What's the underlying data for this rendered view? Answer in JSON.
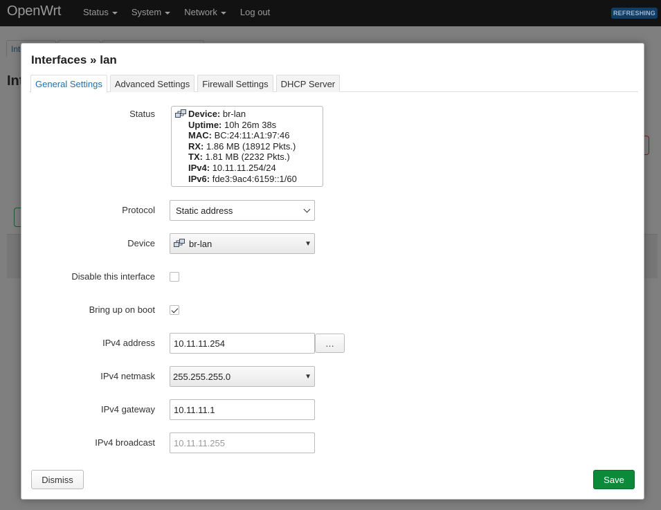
{
  "header": {
    "brand": "OpenWrt",
    "menu": [
      "Status",
      "System",
      "Network"
    ],
    "logout": "Log out",
    "badge": "REFRESHING"
  },
  "background": {
    "tabs": [
      "Int",
      "",
      ""
    ],
    "title": "Int"
  },
  "modal": {
    "title": "Interfaces » lan",
    "tabs": [
      "General Settings",
      "Advanced Settings",
      "Firewall Settings",
      "DHCP Server"
    ],
    "status": {
      "label": "Status",
      "lines": [
        {
          "key": "Device:",
          "value": "br-lan"
        },
        {
          "key": "Uptime:",
          "value": "10h 26m 38s"
        },
        {
          "key": "MAC:",
          "value": "BC:24:11:A1:97:46"
        },
        {
          "key": "RX:",
          "value": "1.86 MB (18912 Pkts.)"
        },
        {
          "key": "TX:",
          "value": "1.81 MB (2232 Pkts.)"
        },
        {
          "key": "IPv4:",
          "value": "10.11.11.254/24"
        },
        {
          "key": "IPv6:",
          "value": "fde3:9ac4:6159::1/60"
        }
      ]
    },
    "protocol": {
      "label": "Protocol",
      "value": "Static address"
    },
    "device": {
      "label": "Device",
      "value": "br-lan"
    },
    "disable": {
      "label": "Disable this interface",
      "checked": false
    },
    "bringup": {
      "label": "Bring up on boot",
      "checked": true
    },
    "ipv4_address": {
      "label": "IPv4 address",
      "value": "10.11.11.254",
      "extra_button": "…"
    },
    "ipv4_netmask": {
      "label": "IPv4 netmask",
      "value": "255.255.255.0"
    },
    "ipv4_gateway": {
      "label": "IPv4 gateway",
      "value": "10.11.11.1"
    },
    "ipv4_broadcast": {
      "label": "IPv4 broadcast",
      "placeholder": "10.11.11.255"
    },
    "dismiss": "Dismiss",
    "save": "Save"
  },
  "colors": {
    "active_tab": "#1f6fb2",
    "save_button": "#0b8a3a",
    "topbar": "#121212"
  }
}
